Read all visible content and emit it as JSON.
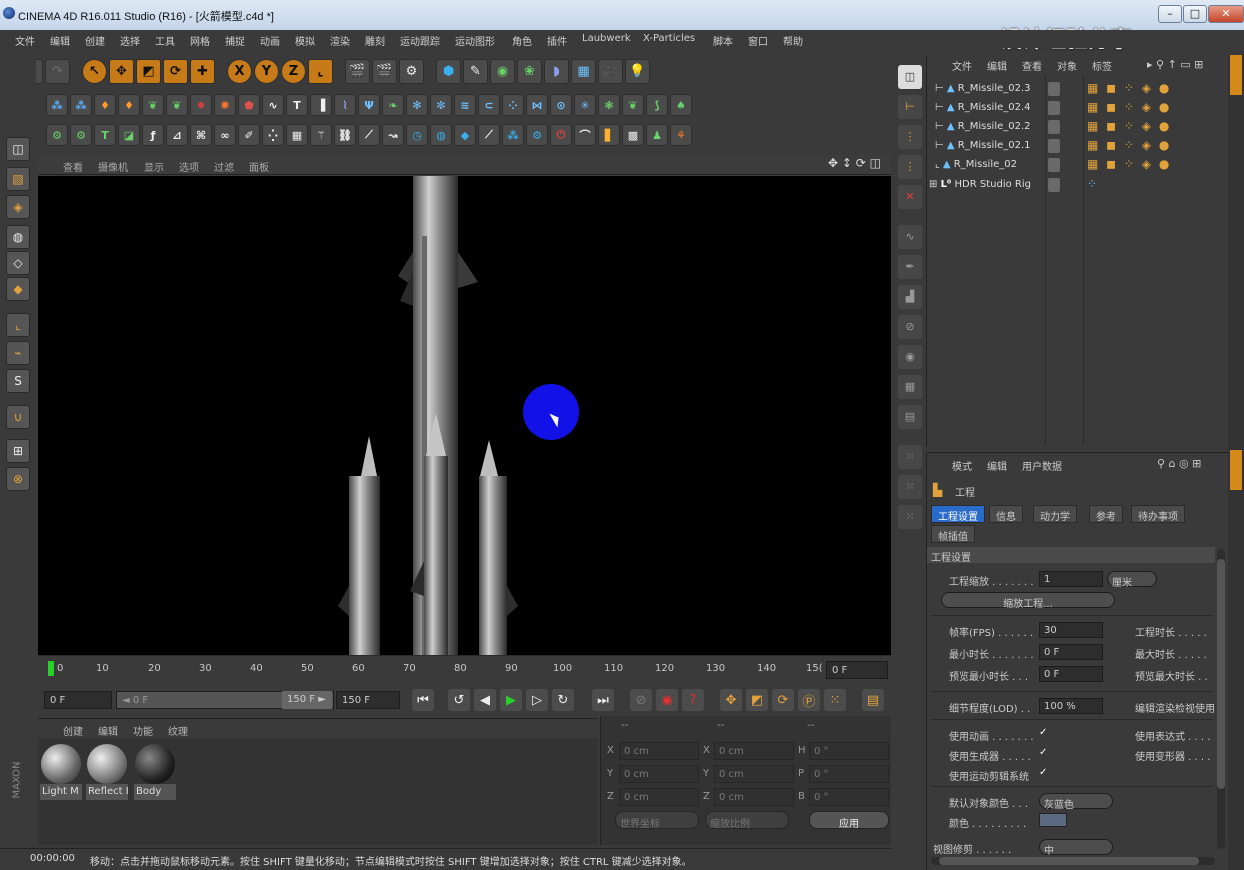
{
  "window": {
    "title": "CINEMA 4D R16.011 Studio (R16) - [火箭模型.c4d *]",
    "buttons": [
      "–",
      "□",
      "✕"
    ]
  },
  "watermark": "设计经验分享",
  "menu": [
    "文件",
    "编辑",
    "创建",
    "选择",
    "工具",
    "网格",
    "捕捉",
    "动画",
    "模拟",
    "渲染",
    "雕刻",
    "运动跟踪",
    "运动图形",
    "角色",
    "插件",
    "Laubwerk",
    "X-Particles",
    "脚本",
    "窗口",
    "帮助"
  ],
  "viewport_menu": [
    "查看",
    "摄像机",
    "显示",
    "选项",
    "过滤",
    "面板"
  ],
  "timeline": {
    "ticks": [
      "0",
      "10",
      "20",
      "30",
      "40",
      "50",
      "60",
      "70",
      "80",
      "90",
      "100",
      "110",
      "120",
      "130",
      "140",
      "15("
    ],
    "current_frame": "0 F"
  },
  "transport": {
    "start_field": "0 F",
    "range_left": "◄ 0 F",
    "range_right": "150 F ►",
    "end_field": "150 F"
  },
  "material_menu": [
    "创建",
    "编辑",
    "功能",
    "纹理"
  ],
  "materials": [
    {
      "name": "Light M"
    },
    {
      "name": "Reflect I"
    },
    {
      "name": "Body"
    }
  ],
  "coords": {
    "header": [
      "--",
      "--",
      "--"
    ],
    "rows": [
      {
        "a": "X",
        "av": "0 cm",
        "b": "X",
        "bv": "0 cm",
        "c": "H",
        "cv": "0 °"
      },
      {
        "a": "Y",
        "av": "0 cm",
        "b": "Y",
        "bv": "0 cm",
        "c": "P",
        "cv": "0 °"
      },
      {
        "a": "Z",
        "av": "0 cm",
        "b": "Z",
        "bv": "0 cm",
        "c": "B",
        "cv": "0 °"
      }
    ],
    "world": "世界坐标",
    "scale": "缩放比例",
    "apply": "应用"
  },
  "status": {
    "time": "00:00:00",
    "message": "移动：点击并拖动鼠标移动元素。按住 SHIFT 键量化移动；节点编辑模式时按住 SHIFT 键增加选择对象；按住 CTRL 键减少选择对象。"
  },
  "object_manager": {
    "menu": [
      "文件",
      "编辑",
      "查看",
      "对象",
      "标签"
    ],
    "objects": [
      {
        "name": "R_Missile_02.3"
      },
      {
        "name": "R_Missile_02.4"
      },
      {
        "name": "R_Missile_02.2"
      },
      {
        "name": "R_Missile_02.1"
      },
      {
        "name": "R_Missile_02"
      },
      {
        "name": "HDR Studio Rig"
      }
    ]
  },
  "attribute_manager": {
    "menu": [
      "模式",
      "编辑",
      "用户数据"
    ],
    "object_title": "工程",
    "tabs": [
      "工程设置",
      "信息",
      "动力学",
      "参考",
      "待办事项"
    ],
    "tab2": "帧插值",
    "section": "工程设置",
    "scale_label": "工程缩放 . . . . . . .",
    "scale_value": "1",
    "scale_unit": "厘米",
    "scale_button": "缩放工程...",
    "fps_label": "帧率(FPS) . . . . . .",
    "fps_value": "30",
    "project_time_label": "工程时长 . . . . .",
    "min_time_label": "最小时长 . . . . . . .",
    "min_time_value": "0 F",
    "max_time_label": "最大时长 . . . . .",
    "preview_min_label": "预览最小时长 . . .",
    "preview_min_value": "0 F",
    "preview_max_label": "预览最大时长 . .",
    "lod_label": "细节程度(LOD) . .",
    "lod_value": "100 %",
    "render_lod_label": "编辑渲染检视使用",
    "use_anim_label": "使用动画 . . . . . . .",
    "use_expr_label": "使用表达式 . . . .",
    "use_gen_label": "使用生成器 . . . . .",
    "use_deform_label": "使用变形器 . . . .",
    "use_mograph_label": "使用运动剪辑系统",
    "check": "✓",
    "default_color_label": "默认对象颜色 . . .",
    "default_color_value": "灰蓝色",
    "color_label": "颜色 . . . . . . . . .",
    "clip_label": "视图修剪 . . . . . .",
    "clip_value": "中"
  },
  "colors": {
    "accent_blue": "#2a6bc9",
    "orange": "#c77a18",
    "cursor_dot": "#1212e8"
  }
}
